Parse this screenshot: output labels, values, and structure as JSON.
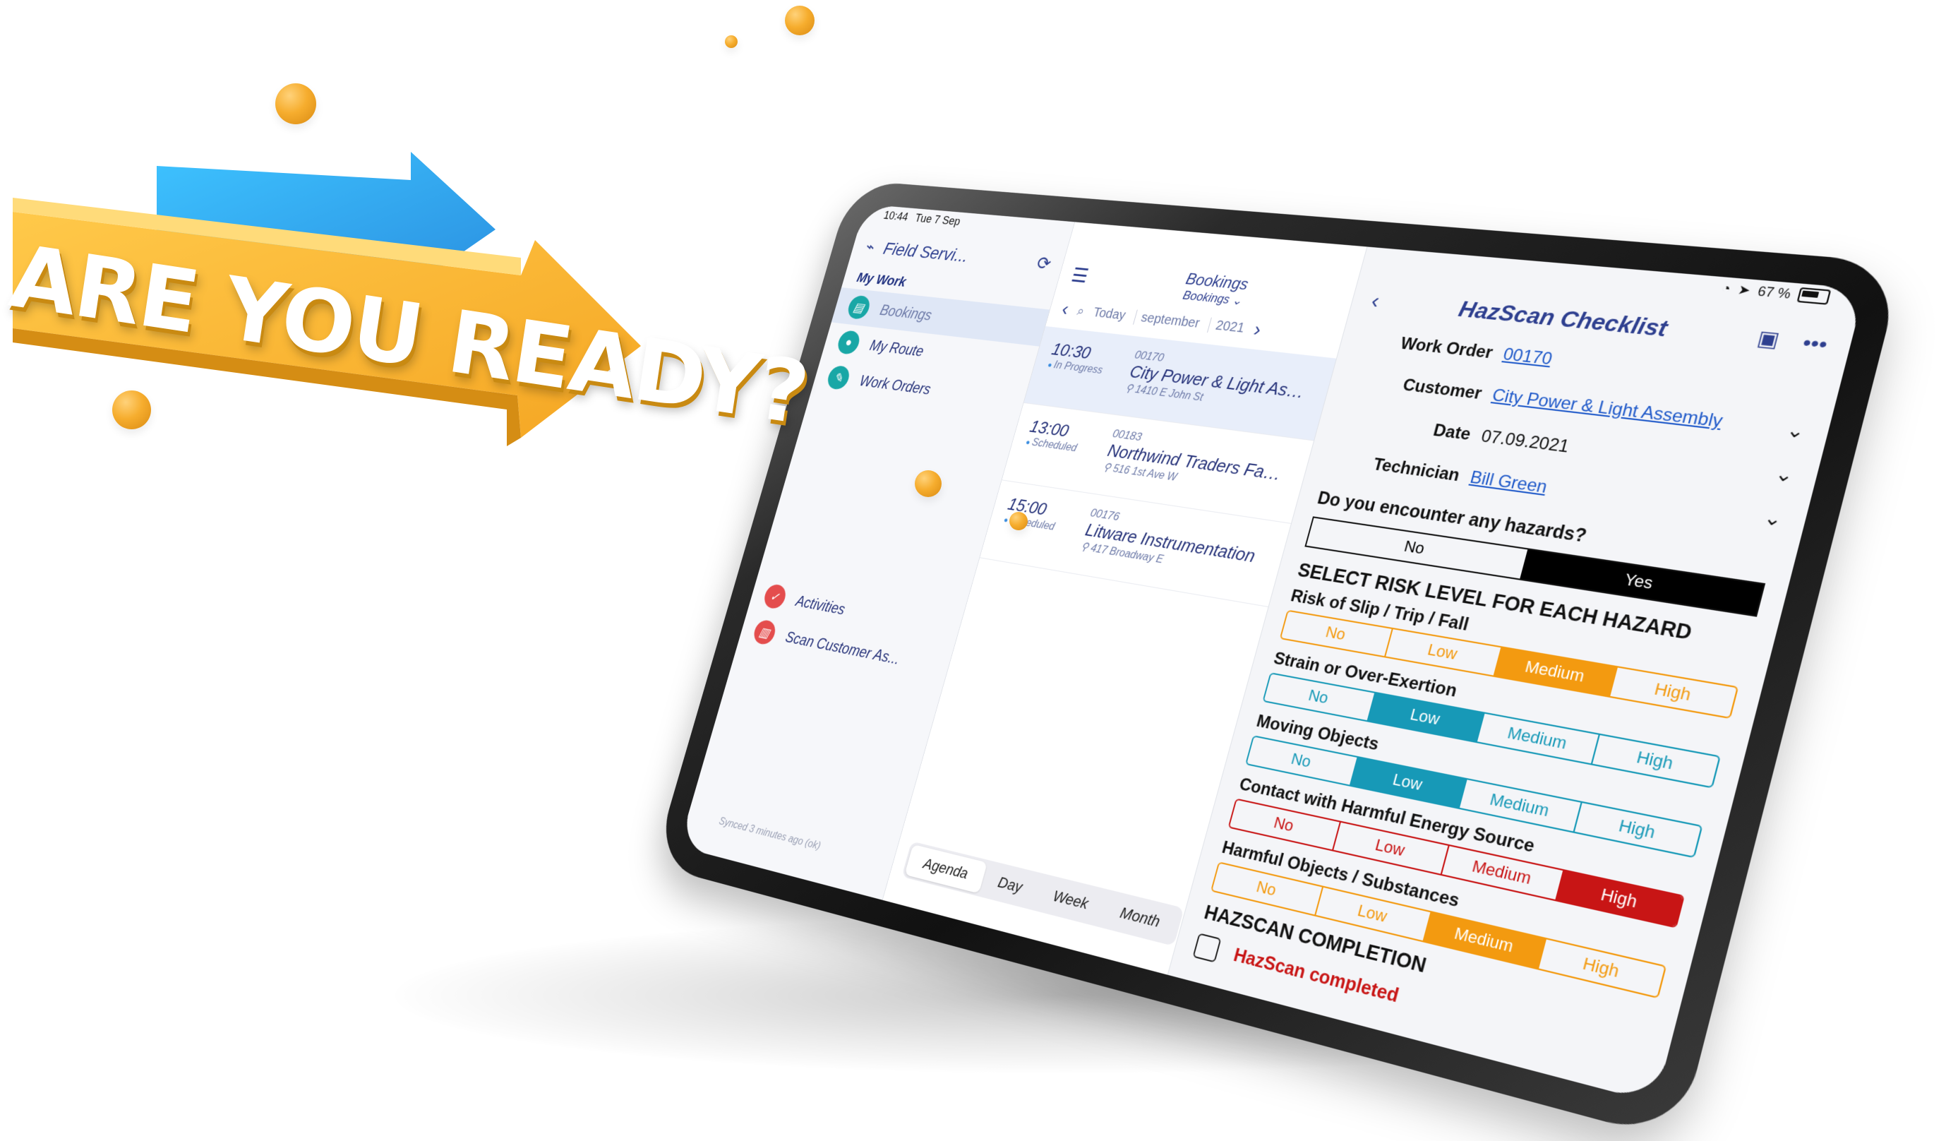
{
  "headline": "ARE YOU READY?",
  "status_bar": {
    "time": "10:44",
    "date": "Tue 7 Sep",
    "battery": "67 %"
  },
  "nav": {
    "app_title": "Field Servi...",
    "section": "My Work",
    "items": [
      {
        "label": "Bookings",
        "icon": "calendar-icon",
        "selected": true
      },
      {
        "label": "My Route",
        "icon": "pin-icon"
      },
      {
        "label": "Work Orders",
        "icon": "wrench-icon"
      },
      {
        "label": "Activities",
        "icon": "activity-icon"
      },
      {
        "label": "Scan Customer As...",
        "icon": "barcode-icon"
      }
    ],
    "synced": "Synced 3 minutes ago (ok)"
  },
  "bookings": {
    "title": "Bookings",
    "view_selector": "Bookings",
    "today": "Today",
    "month": "september",
    "year": "2021",
    "items": [
      {
        "time": "10:30",
        "status": "In Progress",
        "number": "00170",
        "name": "City Power & Light Asse...",
        "address": "1410 E John St",
        "active": true
      },
      {
        "time": "13:00",
        "status": "Scheduled",
        "number": "00183",
        "name": "Northwind Traders Fabri...",
        "address": "516 1st Ave W"
      },
      {
        "time": "15:00",
        "status": "Scheduled",
        "number": "00176",
        "name": "Litware Instrumentation",
        "address": "417 Broadway E"
      }
    ],
    "views": [
      "Agenda",
      "Day",
      "Week",
      "Month"
    ],
    "selected_view": "Agenda"
  },
  "checklist": {
    "title": "HazScan Checklist",
    "fields": [
      {
        "label": "Work Order",
        "value": "00170",
        "link": true
      },
      {
        "label": "Customer",
        "value": "City Power & Light Assembly",
        "link": true
      },
      {
        "label": "Date",
        "value": "07.09.2021",
        "link": false
      },
      {
        "label": "Technician",
        "value": "Bill Green",
        "link": true
      }
    ],
    "question": "Do you encounter any hazards?",
    "no_label": "No",
    "yes_label": "Yes",
    "answer": "Yes",
    "section_title": "SELECT RISK LEVEL FOR EACH HAZARD",
    "levels": [
      "No",
      "Low",
      "Medium",
      "High"
    ],
    "hazards": [
      {
        "name": "Risk of Slip / Trip / Fall",
        "selected": "Medium",
        "color": "#f39a10"
      },
      {
        "name": "Strain or Over-Exertion",
        "selected": "Low",
        "color": "#1799b7"
      },
      {
        "name": "Moving Objects",
        "selected": "Low",
        "color": "#1799b7"
      },
      {
        "name": "Contact with Harmful Energy Source",
        "selected": "High",
        "color": "#c81515"
      },
      {
        "name": "Harmful Objects / Substances",
        "selected": "Medium",
        "color": "#f39a10"
      }
    ],
    "completion_title": "HAZSCAN COMPLETION",
    "completion_label": "HazScan completed"
  },
  "colors": {
    "accent": "#2e3f8f",
    "arrow_yellow": "#fbb73a",
    "arrow_blue": "#3aa8ec",
    "ball": "#f6ad2e"
  }
}
